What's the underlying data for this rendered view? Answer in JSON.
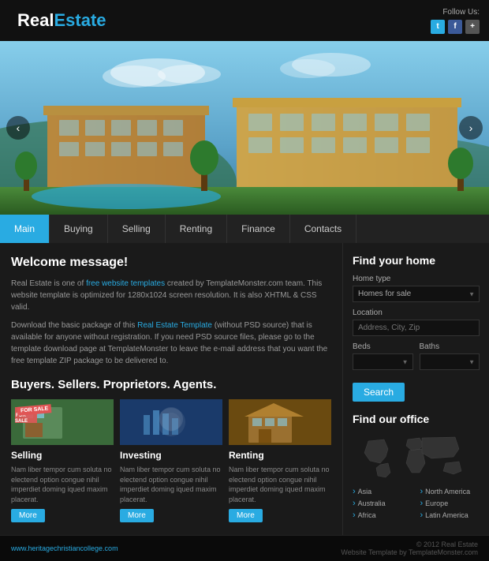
{
  "header": {
    "logo_real": "Real",
    "logo_estate": "Estate",
    "follow_label": "Follow Us:"
  },
  "social": [
    {
      "name": "twitter",
      "label": "t"
    },
    {
      "name": "facebook",
      "label": "f"
    },
    {
      "name": "plus",
      "label": "+"
    }
  ],
  "nav": {
    "items": [
      {
        "label": "Main",
        "active": true
      },
      {
        "label": "Buying",
        "active": false
      },
      {
        "label": "Selling",
        "active": false
      },
      {
        "label": "Renting",
        "active": false
      },
      {
        "label": "Finance",
        "active": false
      },
      {
        "label": "Contacts",
        "active": false
      }
    ]
  },
  "welcome": {
    "title": "Welcome message!",
    "para1": "Real Estate is one of free website templates created by TemplateMonster.com team. This website template is optimized for 1280x1024 screen resolution. It is also XHTML & CSS valid.",
    "para2_pre": "Download the basic package of this ",
    "para2_link": "Real Estate Template",
    "para2_post": " (without PSD source) that is available for anyone without registration. If you need PSD source files, please go to the template download page at TemplateMonster to leave the e-mail address that you want the free template ZIP package to be delivered to.",
    "link_text": "free website templates"
  },
  "section": {
    "subtitle": "Buyers. Sellers. Proprietors. Agents."
  },
  "cards": [
    {
      "type": "sell",
      "title": "Selling",
      "text": "Nam liber tempor cum soluta no electend option congue nihil imperdiet doming iqued maxim placerat."
    },
    {
      "type": "invest",
      "title": "Investing",
      "text": "Nam liber tempor cum soluta no electend option congue nihil imperdiet doming iqued maxim placerat."
    },
    {
      "type": "rent",
      "title": "Renting",
      "text": "Nam liber tempor cum soluta no electend option congue nihil imperdiet doming iqued maxim placerat."
    }
  ],
  "card_more_label": "More",
  "sidebar": {
    "find_title": "Find your home",
    "home_type_label": "Home type",
    "home_type_value": "Homes for sale",
    "location_label": "Location",
    "location_placeholder": "Address, City, Zip",
    "beds_label": "Beds",
    "baths_label": "Baths",
    "search_label": "Search",
    "office_title": "Find our office"
  },
  "map_regions": [
    {
      "label": "Asia"
    },
    {
      "label": "Australia"
    },
    {
      "label": "Africa"
    },
    {
      "label": "North America"
    },
    {
      "label": "Europe"
    },
    {
      "label": "Latin America"
    }
  ],
  "footer": {
    "url": "www.heritagechristiancollege.com",
    "copy": "© 2012 Real Estate",
    "by": "Website Template by TemplateMonster.com"
  }
}
